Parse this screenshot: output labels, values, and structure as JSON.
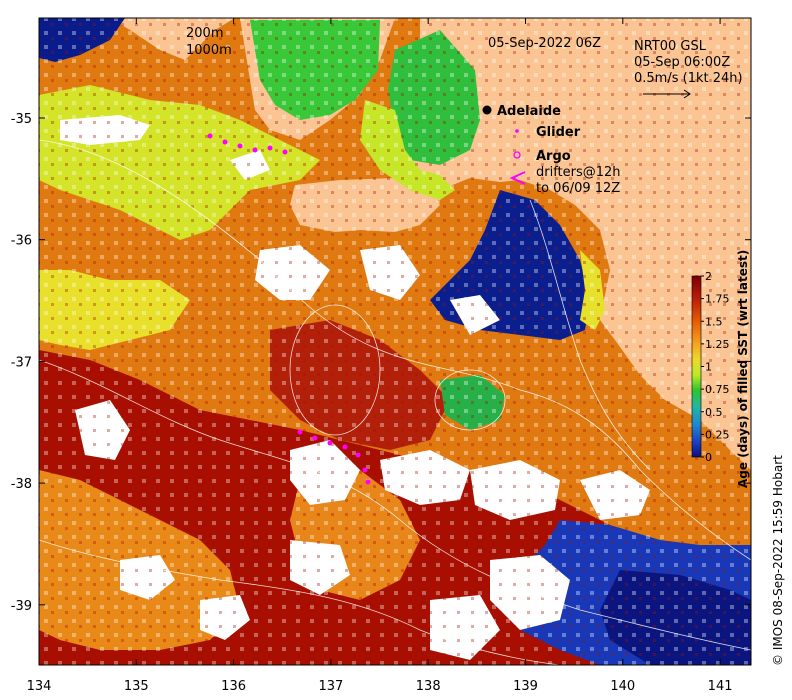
{
  "title": "05-Sep-2022 06Z",
  "info": {
    "line1": "NRT00 GSL",
    "line2": "05-Sep 06:00Z",
    "line3": "0.5m/s (1kt 24h)"
  },
  "contours": {
    "label1": "200m",
    "label2": "1000m"
  },
  "legend": {
    "adelaide": "Adelaide",
    "glider": "Glider",
    "argo": "Argo",
    "drifters1": "drifters@12h",
    "drifters2": "to 06/09 12Z"
  },
  "colorbar": {
    "label": "Age (days) of filled SST (wrt latest)",
    "ticks": [
      "2",
      "1.75",
      "1.5",
      "1.25",
      "1",
      "0.75",
      "0.5",
      "0.25",
      "0"
    ],
    "colors": [
      "#8b0000",
      "#b22222",
      "#e04a00",
      "#f39a1c",
      "#f5c030",
      "#e6e62a",
      "#aaea28",
      "#2cc42c",
      "#24b898",
      "#1e90d0",
      "#1a3ec0",
      "#0a1080"
    ]
  },
  "axes": {
    "x_ticks": [
      "134",
      "135",
      "136",
      "137",
      "138",
      "139",
      "140",
      "141"
    ],
    "y_ticks": [
      "-35",
      "-36",
      "-37",
      "-38",
      "-39"
    ]
  },
  "credit": "© IMOS 08-Sep-2022 15:59 Hobart",
  "colors": {
    "land": "#fbc593",
    "deep_red": "#a50f00",
    "orange": "#e0780c",
    "light_orange": "#f09a20",
    "yellow_green": "#d8e628",
    "green": "#2ecb2e",
    "dark_blue": "#0a1c8c",
    "blue": "#1a4ec8",
    "white": "#ffffff",
    "glider": "#ff00ff"
  }
}
